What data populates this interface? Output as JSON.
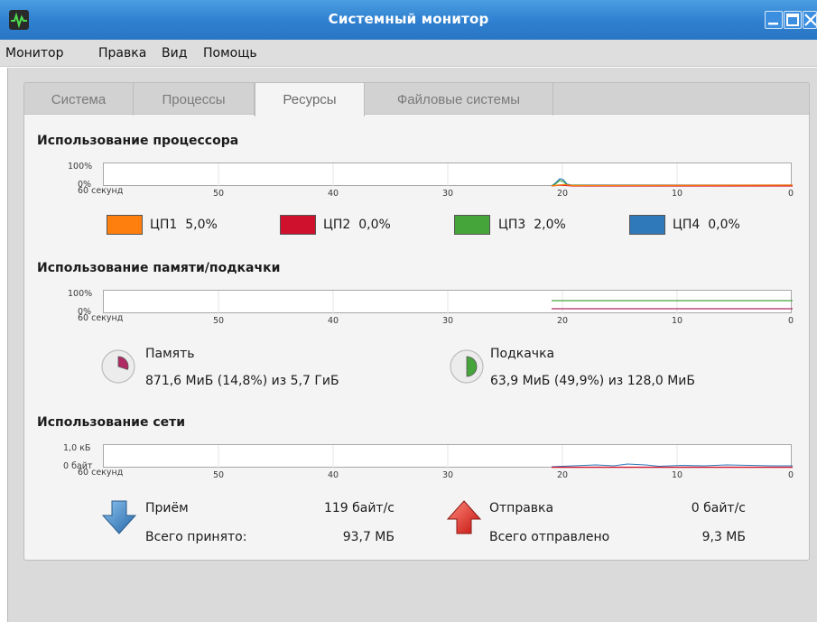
{
  "window": {
    "title": "Системный монитор"
  },
  "menu": {
    "items": [
      {
        "label": "Монитор"
      },
      {
        "label": "Правка"
      },
      {
        "label": "Вид"
      },
      {
        "label": "Помощь"
      }
    ]
  },
  "tabs": [
    {
      "label": "Система",
      "active": false
    },
    {
      "label": "Процессы",
      "active": false
    },
    {
      "label": "Ресурсы",
      "active": true
    },
    {
      "label": "Файловые системы",
      "active": false
    }
  ],
  "x_axis": {
    "ticks": [
      "60 секунд",
      "50",
      "40",
      "30",
      "20",
      "10",
      "0"
    ]
  },
  "cpu": {
    "title": "Использование процессора",
    "y_top": "100%",
    "y_bottom": "0%",
    "legend": [
      {
        "label": "ЦП1",
        "value": "5,0%",
        "color": "#ff7f0e"
      },
      {
        "label": "ЦП2",
        "value": "0,0%",
        "color": "#d0112d"
      },
      {
        "label": "ЦП3",
        "value": "2,0%",
        "color": "#46a53a"
      },
      {
        "label": "ЦП4",
        "value": "0,0%",
        "color": "#2f78b9"
      }
    ]
  },
  "memory": {
    "title": "Использование памяти/подкачки",
    "y_top": "100%",
    "y_bottom": "0%",
    "mem": {
      "label": "Память",
      "value": "871,6 МиБ (14,8%) из 5,7 ГиБ",
      "color": "#b02a63",
      "fraction": 0.148
    },
    "swap": {
      "label": "Подкачка",
      "value": "63,9 МиБ (49,9%) из 128,0 МиБ",
      "color": "#46a53a",
      "fraction": 0.499
    }
  },
  "network": {
    "title": "Использование сети",
    "y_top": "1,0 кБ",
    "y_bottom": "0 байт",
    "rx": {
      "label": "Приём",
      "rate": "119 байт/с",
      "total_label": "Всего принято:",
      "total": "93,7 МБ",
      "color": "#2f78b9"
    },
    "tx": {
      "label": "Отправка",
      "rate": "0 байт/с",
      "total_label": "Всего отправлено",
      "total": "9,3 МБ",
      "color": "#d0112d"
    }
  }
}
